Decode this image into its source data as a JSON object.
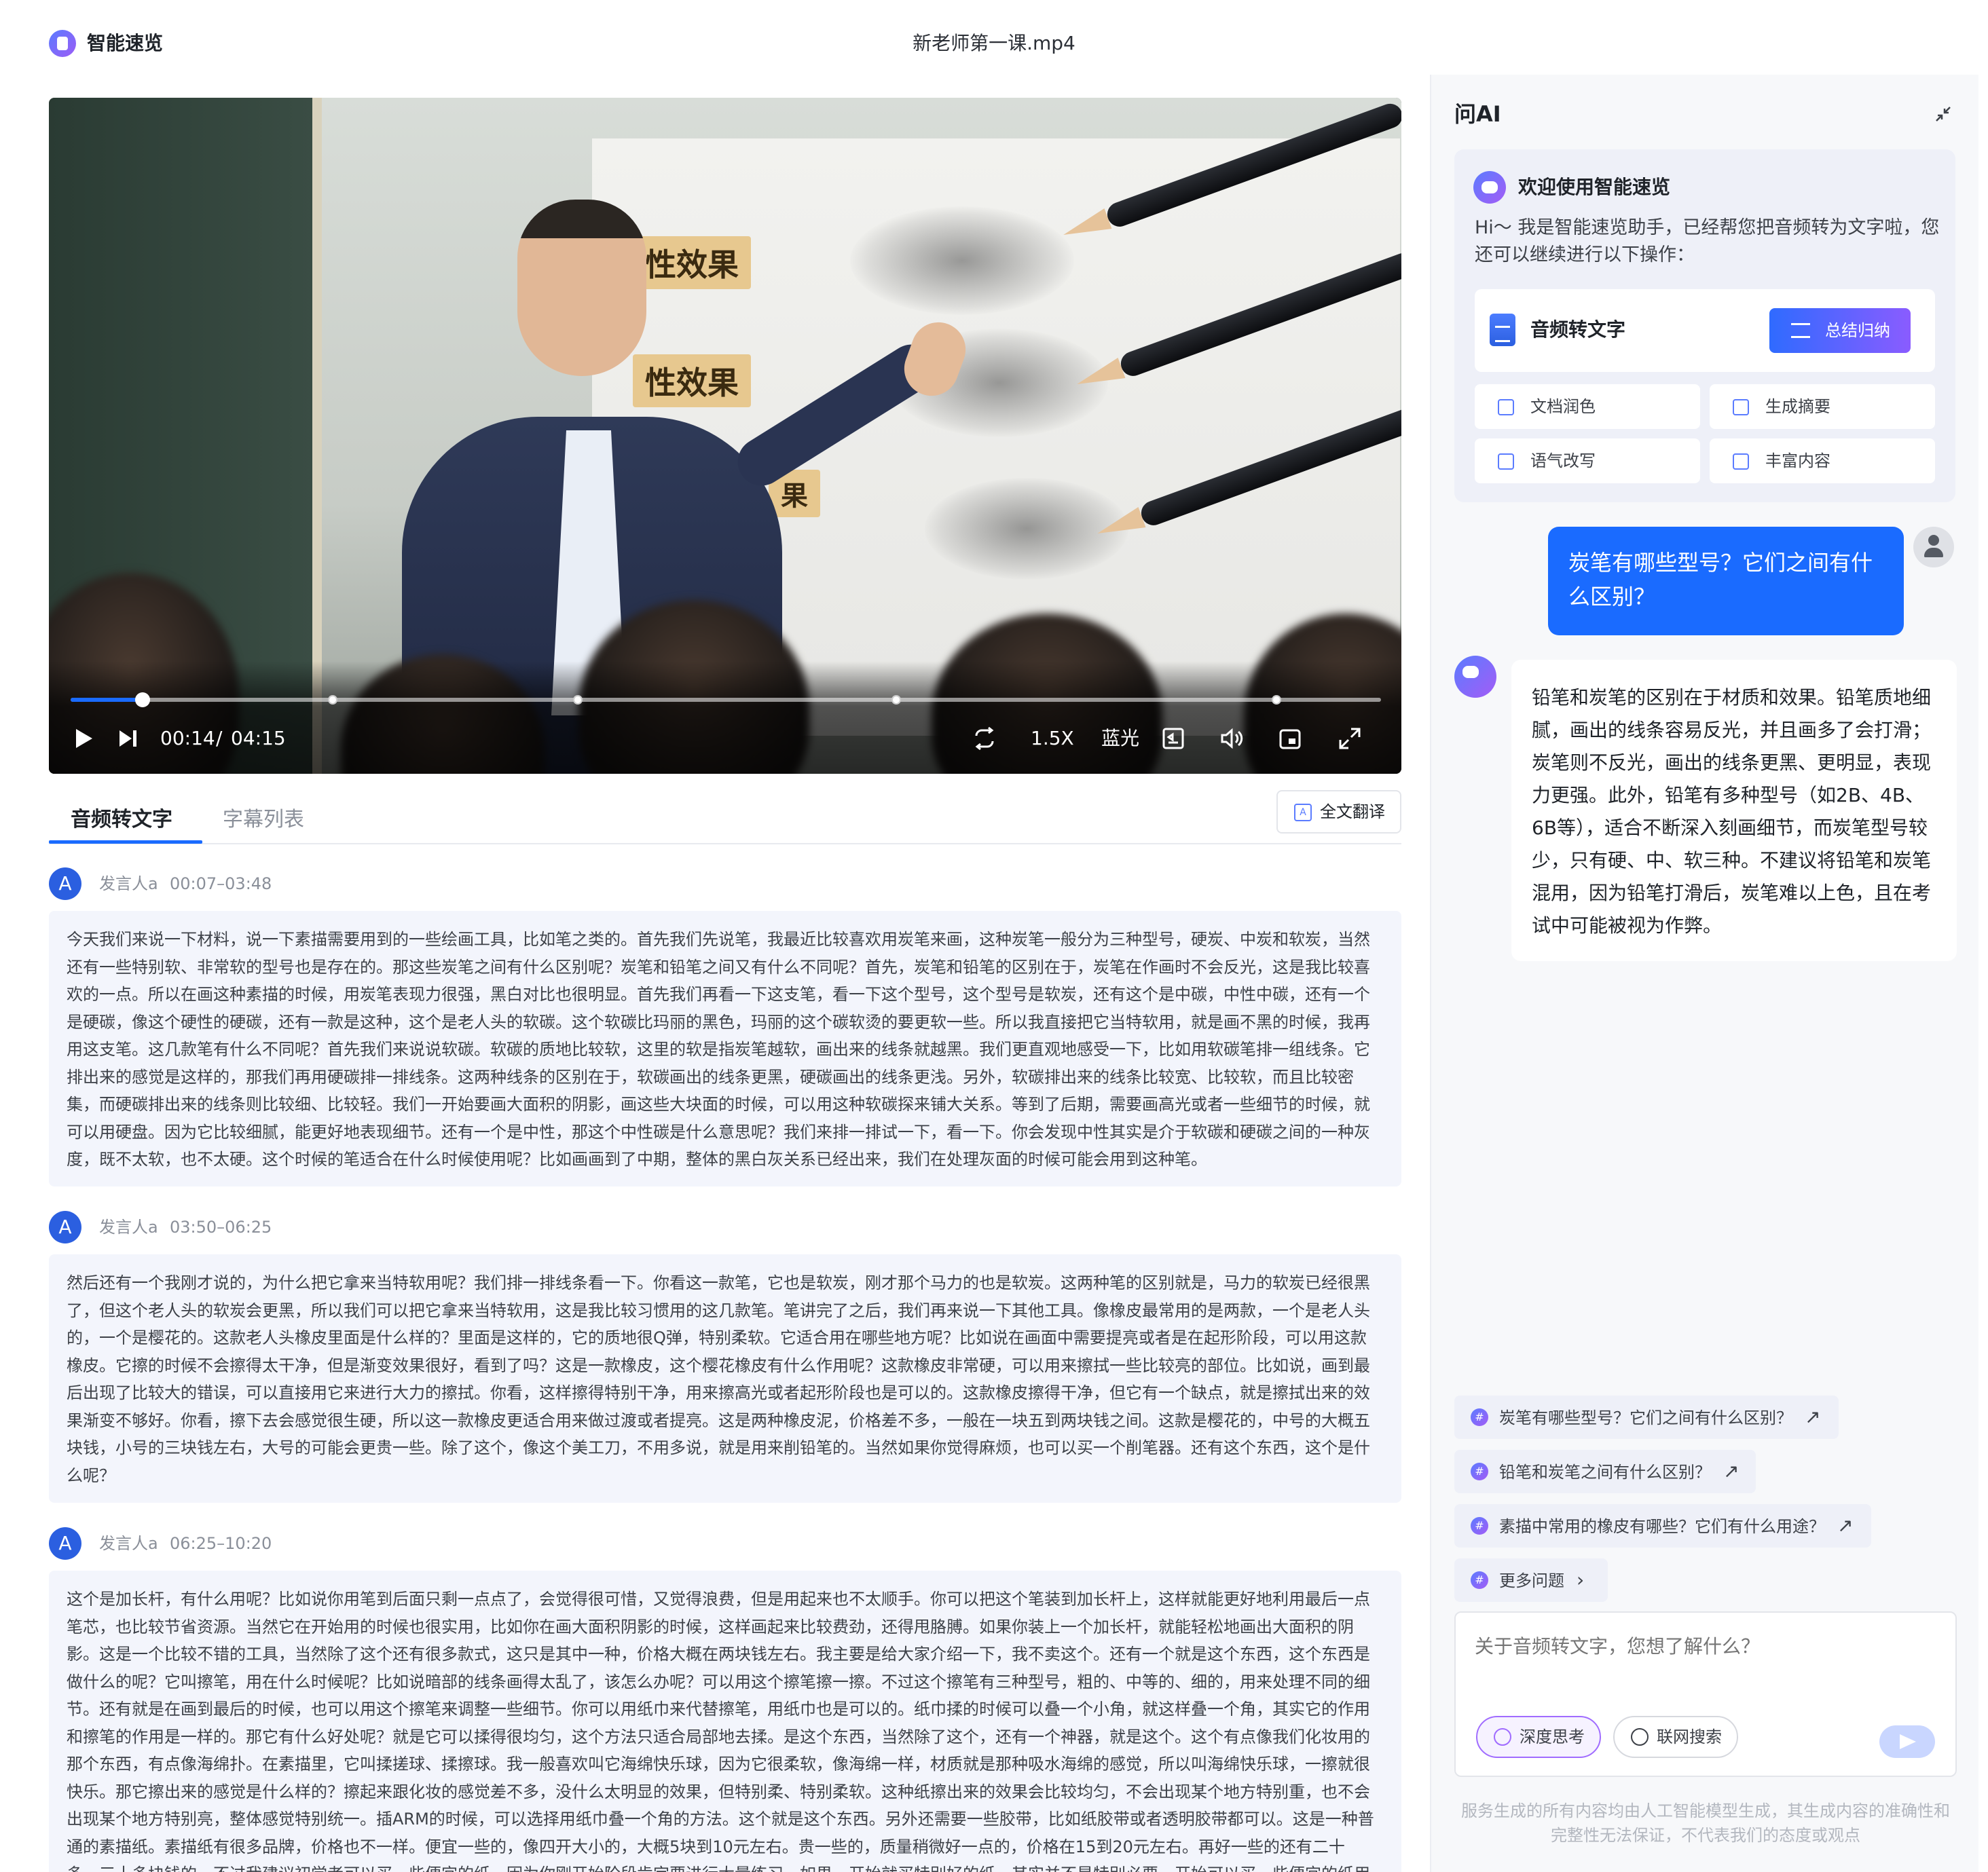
{
  "header": {
    "app_title": "智能速览",
    "file_title": "新老师第一课.mp4"
  },
  "video": {
    "tags": [
      "性效果",
      "性效果",
      "果"
    ],
    "current_time": "00:14",
    "separator": "/",
    "duration": "04:15",
    "progress": 0.055,
    "chapter_markers": [
      0.2,
      0.387,
      0.63,
      0.92
    ],
    "speed_label": "1.5X",
    "quality_label": "蓝光",
    "accent_color": "#1a6bff"
  },
  "tabs": {
    "active": "音频转文字",
    "inactive": "字幕列表"
  },
  "translate_button": "全文翻译",
  "transcript": [
    {
      "avatar": "A",
      "speaker": "发言人a",
      "time": "00:07–03:48",
      "text": "今天我们来说一下材料，说一下素描需要用到的一些绘画工具，比如笔之类的。首先我们先说笔，我最近比较喜欢用炭笔来画，这种炭笔一般分为三种型号，硬炭、中炭和软炭，当然还有一些特别软、非常软的型号也是存在的。那这些炭笔之间有什么区别呢？炭笔和铅笔之间又有什么不同呢？首先，炭笔和铅笔的区别在于，炭笔在作画时不会反光，这是我比较喜欢的一点。所以在画这种素描的时候，用炭笔表现力很强，黑白对比也很明显。首先我们再看一下这支笔，看一下这个型号，这个型号是软炭，还有这个是中碳，中性中碳，还有一个是硬碳，像这个硬性的硬碳，还有一款是这种，这个是老人头的软碳。这个软碳比玛丽的黑色，玛丽的这个碳软烫的要更软一些。所以我直接把它当特软用，就是画不黑的时候，我再用这支笔。这几款笔有什么不同呢？首先我们来说说软碳。软碳的质地比较软，这里的软是指炭笔越软，画出来的线条就越黑。我们更直观地感受一下，比如用软碳笔排一组线条。它排出来的感觉是这样的，那我们再用硬碳排一排线条。这两种线条的区别在于，软碳画出的线条更黑，硬碳画出的线条更浅。另外，软碳排出来的线条比较宽、比较软，而且比较密集，而硬碳排出来的线条则比较细、比较轻。我们一开始要画大面积的阴影，画这些大块面的时候，可以用这种软碳探来铺大关系。等到了后期，需要画高光或者一些细节的时候，就可以用硬盘。因为它比较细腻，能更好地表现细节。还有一个是中性，那这个中性碳是什么意思呢？我们来排一排试一下，看一下。你会发现中性其实是介于软碳和硬碳之间的一种灰度，既不太软，也不太硬。这个时候的笔适合在什么时候使用呢？比如画画到了中期，整体的黑白灰关系已经出来，我们在处理灰面的时候可能会用到这种笔。"
    },
    {
      "avatar": "A",
      "speaker": "发言人a",
      "time": "03:50–06:25",
      "text": "然后还有一个我刚才说的，为什么把它拿来当特软用呢？我们排一排线条看一下。你看这一款笔，它也是软炭，刚才那个马力的也是软炭。这两种笔的区别就是，马力的软炭已经很黑了，但这个老人头的软炭会更黑，所以我们可以把它拿来当特软用，这是我比较习惯用的这几款笔。笔讲完了之后，我们再来说一下其他工具。像橡皮最常用的是两款，一个是老人头的，一个是樱花的。这款老人头橡皮里面是什么样的？里面是这样的，它的质地很Q弹，特别柔软。它适合用在哪些地方呢？比如说在画面中需要提亮或者是在起形阶段，可以用这款橡皮。它擦的时候不会擦得太干净，但是渐变效果很好，看到了吗？这是一款橡皮，这个樱花橡皮有什么作用呢？这款橡皮非常硬，可以用来擦拭一些比较亮的部位。比如说，画到最后出现了比较大的错误，可以直接用它来进行大力的擦拭。你看，这样擦得特别干净，用来擦高光或者起形阶段也是可以的。这款橡皮擦得干净，但它有一个缺点，就是擦拭出来的效果渐变不够好。你看，擦下去会感觉很生硬，所以这一款橡皮更适合用来做过渡或者提亮。这是两种橡皮泥，价格差不多，一般在一块五到两块钱之间。这款是樱花的，中号的大概五块钱，小号的三块钱左右，大号的可能会更贵一些。除了这个，像这个美工刀，不用多说，就是用来削铅笔的。当然如果你觉得麻烦，也可以买一个削笔器。还有这个东西，这个是什么呢？"
    },
    {
      "avatar": "A",
      "speaker": "发言人a",
      "time": "06:25–10:20",
      "text": "这个是加长杆，有什么用呢？比如说你用笔到后面只剩一点点了，会觉得很可惜，又觉得浪费，但是用起来也不太顺手。你可以把这个笔装到加长杆上，这样就能更好地利用最后一点笔芯，也比较节省资源。当然它在开始用的时候也很实用，比如你在画大面积阴影的时候，这样画起来比较费劲，还得甩胳膊。如果你装上一个加长杆，就能轻松地画出大面积的阴影。这是一个比较不错的工具，当然除了这个还有很多款式，这只是其中一种，价格大概在两块钱左右。我主要是给大家介绍一下，我不卖这个。还有一个就是这个东西，这个东西是做什么的呢？它叫擦笔，用在什么时候呢？比如说暗部的线条画得太乱了，该怎么办呢？可以用这个擦笔擦一擦。不过这个擦笔有三种型号，粗的、中等的、细的，用来处理不同的细节。还有就是在画到最后的时候，也可以用这个擦笔来调整一些细节。你可以用纸巾来代替擦笔，用纸巾也是可以的。纸巾揉的时候可以叠一个小角，就这样叠一个角，其实它的作用和擦笔的作用是一样的。那它有什么好处呢？就是它可以揉得很均匀，这个方法只适合局部地去揉。是这个东西，当然除了这个，还有一个神器，就是这个。这个有点像我们化妆用的那个东西，有点像海绵扑。在素描里，它叫揉搓球、揉擦球。我一般喜欢叫它海绵快乐球，因为它很柔软，像海绵一样，材质就是那种吸水海绵的感觉，所以叫海绵快乐球，一擦就很快乐。那它擦出来的感觉是什么样的？擦起来跟化妆的感觉差不多，没什么太明显的效果，但特别柔、特别柔软。这种纸擦出来的效果会比较均匀，不会出现某个地方特别重，也不会出现某个地方特别亮，整体感觉特别统一。插ARM的时候，可以选择用纸巾叠一个角的方法。这个就是这个东西。另外还需要一些胶带，比如纸胶带或者透明胶带都可以。这是一种普通的素描纸。素描纸有很多品牌，价格也不一样。便宜一些的，像四开大小的，大概5块到10元左右。贵一些的，质量稍微好一点的，价格在15到20元左右。再好一些的还有二十多，三十多块钱的。不过我建议初学者可以买一些便宜的纸。因为你刚开始阶段肯定要进行大量练习，如果一开始就买特别好的纸，其实并不是特别必要。开始可以买一些便宜的纸用来练"
    }
  ],
  "ai_panel": {
    "title": "问AI",
    "welcome_title": "欢迎使用智能速览",
    "welcome_text": "Hi～ 我是智能速览助手，已经帮您把音频转为文字啦，您还可以继续进行以下操作：",
    "feature_label": "音频转文字",
    "summary_button": "总结归纳",
    "chips": [
      "文档润色",
      "生成摘要",
      "语气改写",
      "丰富内容"
    ],
    "user_question": "炭笔有哪些型号？它们之间有什么区别？",
    "answer": "铅笔和炭笔的区别在于材质和效果。铅笔质地细腻，画出的线条容易反光，并且画多了会打滑；炭笔则不反光，画出的线条更黑、更明显，表现力更强。此外，铅笔有多种型号（如2B、4B、6B等），适合不断深入刻画细节，而炭笔型号较少，只有硬、中、软三种。不建议将铅笔和炭笔混用，因为铅笔打滑后，炭笔难以上色，且在考试中可能被视为作弊。",
    "suggestions": [
      "炭笔有哪些型号？它们之间有什么区别？",
      "铅笔和炭笔之间有什么区别？",
      "素描中常用的橡皮有哪些？它们有什么用途？"
    ],
    "more_questions": "更多问题",
    "input_placeholder": "关于音频转文字，您想了解什么？",
    "deep_think": "深度思考",
    "web_search": "联网搜索",
    "disclaimer": "服务生成的所有内容均由人工智能模型生成，其生成内容的准确性和完整性无法保证，不代表我们的态度或观点"
  }
}
